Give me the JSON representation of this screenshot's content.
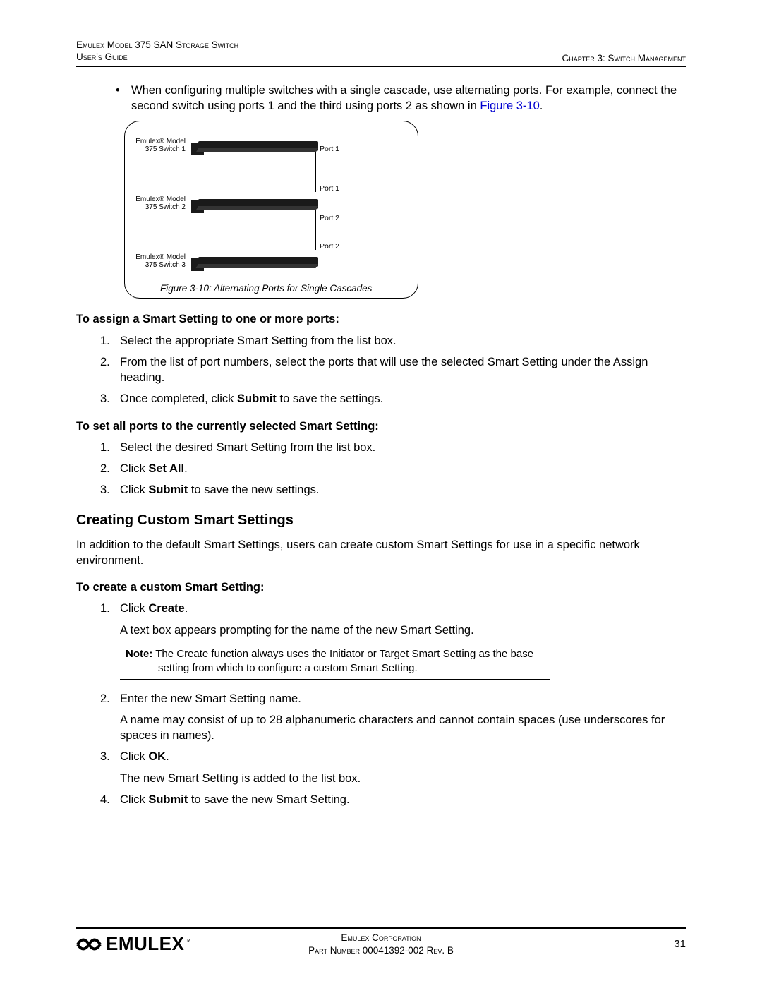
{
  "header": {
    "left_line1": "Emulex Model 375 SAN Storage Switch",
    "left_line2": "User's Guide",
    "right": "Chapter 3: Switch Management"
  },
  "bullet": {
    "text_part1": "When configuring multiple switches with a single cascade, use alternating ports. For example, connect the second switch using ports 1 and the third using ports 2 as shown in ",
    "link": "Figure 3-10",
    "text_part2": "."
  },
  "figure": {
    "switch1_label": "Emulex® Model 375 Switch 1",
    "switch2_label": "Emulex® Model 375 Switch 2",
    "switch3_label": "Emulex® Model 375 Switch 3",
    "port1a": "Port 1",
    "port1b": "Port 1",
    "port2a": "Port 2",
    "port2b": "Port 2",
    "caption": "Figure 3-10: Alternating Ports for Single Cascades"
  },
  "section1": {
    "heading": "To assign a Smart Setting to one or more ports:",
    "items": [
      {
        "num": "1.",
        "text": "Select the appropriate Smart Setting from the list box."
      },
      {
        "num": "2.",
        "text": "From the list of port numbers, select the ports that will use the selected Smart Setting under the Assign heading."
      },
      {
        "num": "3.",
        "pre": "Once completed, click ",
        "bold": "Submit",
        "post": " to save the settings."
      }
    ]
  },
  "section2": {
    "heading": "To set all ports to the currently selected Smart Setting:",
    "items": [
      {
        "num": "1.",
        "text": "Select the desired Smart Setting from the list box."
      },
      {
        "num": "2.",
        "pre": "Click ",
        "bold": "Set All",
        "post": "."
      },
      {
        "num": "3.",
        "pre": "Click ",
        "bold": "Submit",
        "post": " to save the new settings."
      }
    ]
  },
  "h3": "Creating Custom Smart Settings",
  "para": "In addition to the default Smart Settings, users can create custom Smart Settings for use in a specific network environment.",
  "section3": {
    "heading": "To create a custom Smart Setting:",
    "item1": {
      "num": "1.",
      "pre": "Click ",
      "bold": "Create",
      "post": ".",
      "para2": "A text box appears prompting for the name of the new Smart Setting.",
      "note_label": "Note:",
      "note_text": " The Create function always uses the Initiator or Target Smart Setting as the base setting from which to configure a custom Smart Setting."
    },
    "item2": {
      "num": "2.",
      "line1": "Enter the new Smart Setting name.",
      "line2": "A name may consist of up to 28 alphanumeric characters and cannot contain spaces (use underscores for spaces in names)."
    },
    "item3": {
      "num": "3.",
      "pre": "Click ",
      "bold": "OK",
      "post": ".",
      "para2": "The new Smart Setting is added to the list box."
    },
    "item4": {
      "num": "4.",
      "pre": "Click ",
      "bold": "Submit",
      "post": " to save the new Smart Setting."
    }
  },
  "footer": {
    "line1": "Emulex Corporation",
    "line2": "Part Number 00041392-002 Rev. B",
    "page": "31",
    "logo_text": "EMULEX",
    "logo_tm": "™"
  }
}
